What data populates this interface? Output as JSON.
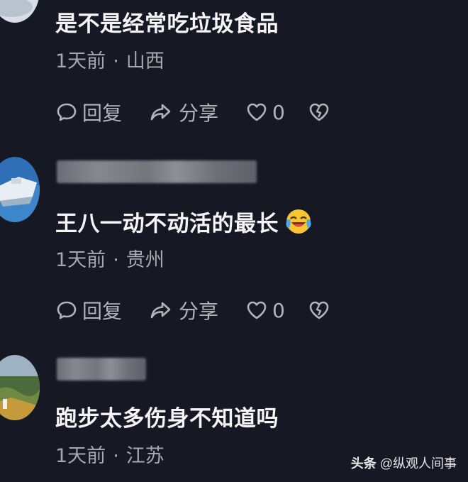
{
  "comments": [
    {
      "text": "是不是经常吃垃圾食品",
      "time": "1天前",
      "location": "山西",
      "reply_label": "回复",
      "share_label": "分享",
      "like_count": "0"
    },
    {
      "text": "王八一动不动活的最长",
      "emoji": "laughing-crying-emoji",
      "time": "1天前",
      "location": "贵州",
      "reply_label": "回复",
      "share_label": "分享",
      "like_count": "0"
    },
    {
      "text": "跑步太多伤身不知道吗",
      "time": "1天前",
      "location": "江苏"
    }
  ],
  "separator": "·",
  "watermark": {
    "brand": "头条",
    "account": "@纵观人间事"
  },
  "icons": [
    "comment-bubble-icon",
    "share-arrow-icon",
    "heart-icon",
    "broken-heart-icon"
  ]
}
